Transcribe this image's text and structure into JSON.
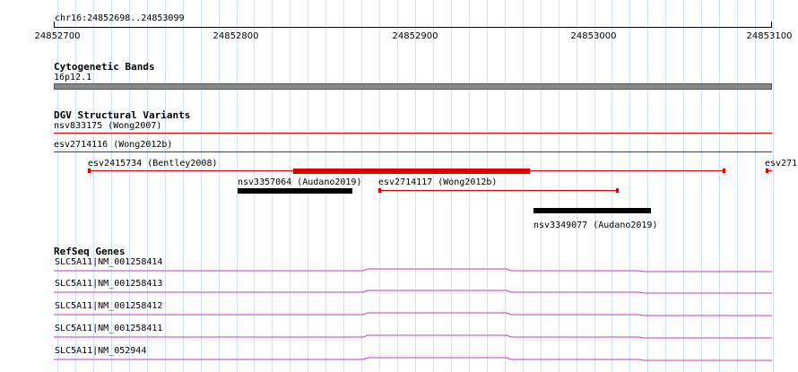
{
  "colors": {
    "grid": "#cfe3f3",
    "cytoband": "#888888",
    "dgv_loss": "#e00000",
    "dgv_gain": "#000000",
    "refseq": "#cc33cc"
  },
  "ruler": {
    "region": "chr16:24852698..24853099",
    "ticks": [
      "24852700",
      "24852800",
      "24852900",
      "24853000",
      "24853100"
    ]
  },
  "tracks": {
    "cytoband": {
      "title": "Cytogenetic Bands",
      "band_label": "16p12.1"
    },
    "dgv": {
      "title": "DGV Structural Variants",
      "features": [
        {
          "id": "nsv833175",
          "label": "nsv833175 (Wong2007)"
        },
        {
          "id": "esv2714116",
          "label": "esv2714116 (Wong2012b)"
        },
        {
          "id": "esv2415734",
          "label": "esv2415734 (Bentley2008)"
        },
        {
          "id": "esv271",
          "label": "esv271"
        },
        {
          "id": "nsv3357064",
          "label": "nsv3357064 (Audano2019)"
        },
        {
          "id": "esv2714117",
          "label": "esv2714117 (Wong2012b)"
        },
        {
          "id": "nsv3349077",
          "label": "nsv3349077 (Audano2019)"
        }
      ]
    },
    "refseq": {
      "title": "RefSeq Genes",
      "transcripts": [
        {
          "label": "SLC5A11|NM_001258414"
        },
        {
          "label": "SLC5A11|NM_001258413"
        },
        {
          "label": "SLC5A11|NM_001258412"
        },
        {
          "label": "SLC5A11|NM_001258411"
        },
        {
          "label": "SLC5A11|NM_052944"
        }
      ]
    }
  }
}
